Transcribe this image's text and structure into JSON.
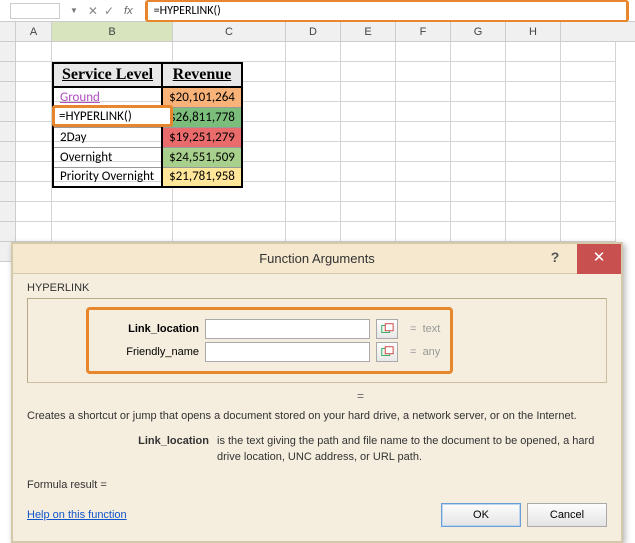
{
  "formula_bar": {
    "name_box": "",
    "formula": "=HYPERLINK()"
  },
  "columns": [
    "A",
    "B",
    "C",
    "D",
    "E",
    "F",
    "G",
    "H"
  ],
  "col_widths": {
    "A": 36,
    "B": 121,
    "C": 113,
    "D": 55,
    "E": 55,
    "F": 55,
    "G": 55,
    "H": 55
  },
  "selected_column": "B",
  "table": {
    "headers": [
      "Service Level",
      "Revenue"
    ],
    "rows": [
      {
        "service": "Ground",
        "revenue": "$20,101,264",
        "class": "rev-orange",
        "service_class": "link-cell"
      },
      {
        "service": "=HYPERLINK()",
        "revenue": "$26,811,778",
        "class": "rev-green",
        "editing": true
      },
      {
        "service": "2Day",
        "revenue": "$19,251,279",
        "class": "rev-red"
      },
      {
        "service": "Overnight",
        "revenue": "$24,551,509",
        "class": "rev-lgreen"
      },
      {
        "service": "Priority Overnight",
        "revenue": "$21,781,958",
        "class": "rev-yellow"
      }
    ]
  },
  "editing_cell_value": "=HYPERLINK()",
  "dialog": {
    "title": "Function Arguments",
    "function_name": "HYPERLINK",
    "args": [
      {
        "label": "Link_location",
        "value": "",
        "bold": true,
        "hint_prefix": "=",
        "hint": "text"
      },
      {
        "label": "Friendly_name",
        "value": "",
        "bold": false,
        "hint_prefix": "=",
        "hint": "any"
      }
    ],
    "equals_sign": "=",
    "description": "Creates a shortcut or jump that opens a document stored on your hard drive, a network server, or on the Internet.",
    "param_name": "Link_location",
    "param_text": "is the text giving the path and file name to the document to be opened, a hard drive location, UNC address, or URL path.",
    "result_label": "Formula result =",
    "result_value": "",
    "help_link": "Help on this function",
    "ok_label": "OK",
    "cancel_label": "Cancel",
    "help_btn": "?",
    "close_btn": "✕"
  },
  "chart_data": {
    "type": "table",
    "title": "Service Level Revenue",
    "columns": [
      "Service Level",
      "Revenue"
    ],
    "rows": [
      [
        "Ground",
        20101264
      ],
      [
        "=HYPERLINK()",
        26811778
      ],
      [
        "2Day",
        19251279
      ],
      [
        "Overnight",
        24551509
      ],
      [
        "Priority Overnight",
        21781958
      ]
    ]
  }
}
